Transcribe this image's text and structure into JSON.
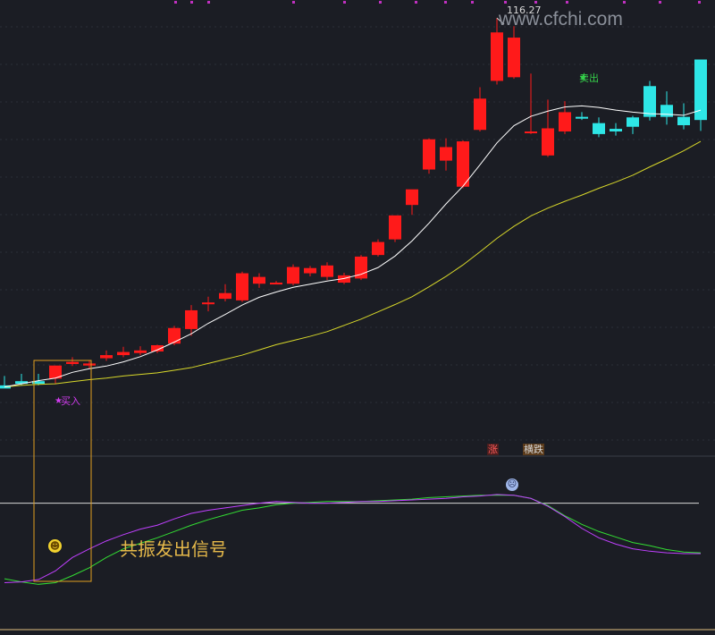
{
  "watermark": "www.cfchi.com",
  "annotations": {
    "peak_price": "116.27",
    "buy_signal": "买入",
    "sell_signal": "卖出",
    "resonance_text": "共振发出信号",
    "tag_rise": "涨",
    "tag_fall": "横跌",
    "buy_marker_icon": "star-icon",
    "sell_marker_icon": "star-icon",
    "smile_icon": "smiley-face-icon",
    "sad_icon": "sad-face-icon"
  },
  "colors": {
    "background": "#1b1d24",
    "up_candle": "#ff1a1a",
    "down_candle": "#2ee6e6",
    "ma_short": "#ffffff",
    "ma_long": "#d8d82a",
    "osc_fast": "#c040ff",
    "osc_slow": "#33dd33",
    "highlight_box": "#e0a020"
  },
  "chart_data": {
    "type": "candlestick",
    "ylim": [
      36,
      118
    ],
    "candles": [
      {
        "o": 45.8,
        "h": 47.6,
        "l": 45.3,
        "c": 45.2,
        "dir": "down"
      },
      {
        "o": 46.6,
        "h": 48.0,
        "l": 45.8,
        "c": 46.1,
        "dir": "down"
      },
      {
        "o": 46.6,
        "h": 48.0,
        "l": 45.8,
        "c": 46.1,
        "dir": "down"
      },
      {
        "o": 47.1,
        "h": 48.7,
        "l": 46.1,
        "c": 49.6,
        "dir": "up"
      },
      {
        "o": 49.9,
        "h": 51.2,
        "l": 49.5,
        "c": 50.3,
        "dir": "up"
      },
      {
        "o": 49.6,
        "h": 50.6,
        "l": 49.0,
        "c": 50.0,
        "dir": "up"
      },
      {
        "o": 51.0,
        "h": 52.5,
        "l": 50.5,
        "c": 51.6,
        "dir": "up"
      },
      {
        "o": 51.6,
        "h": 53.2,
        "l": 51.2,
        "c": 52.2,
        "dir": "up"
      },
      {
        "o": 52.0,
        "h": 53.3,
        "l": 51.6,
        "c": 52.5,
        "dir": "up"
      },
      {
        "o": 52.3,
        "h": 53.6,
        "l": 52.0,
        "c": 53.5,
        "dir": "up"
      },
      {
        "o": 53.8,
        "h": 57.2,
        "l": 53.5,
        "c": 56.8,
        "dir": "up"
      },
      {
        "o": 56.6,
        "h": 61.2,
        "l": 55.3,
        "c": 60.2,
        "dir": "up"
      },
      {
        "o": 61.5,
        "h": 62.8,
        "l": 60.0,
        "c": 61.7,
        "dir": "up"
      },
      {
        "o": 62.4,
        "h": 65.2,
        "l": 61.9,
        "c": 63.5,
        "dir": "up"
      },
      {
        "o": 62.1,
        "h": 67.6,
        "l": 61.8,
        "c": 67.3,
        "dir": "up"
      },
      {
        "o": 65.3,
        "h": 67.3,
        "l": 64.5,
        "c": 66.6,
        "dir": "up"
      },
      {
        "o": 65.5,
        "h": 65.8,
        "l": 65.2,
        "c": 65.5,
        "dir": "up"
      },
      {
        "o": 65.3,
        "h": 69.0,
        "l": 65.0,
        "c": 68.5,
        "dir": "up"
      },
      {
        "o": 67.3,
        "h": 68.7,
        "l": 66.7,
        "c": 68.3,
        "dir": "up"
      },
      {
        "o": 66.6,
        "h": 69.4,
        "l": 66.0,
        "c": 68.8,
        "dir": "up"
      },
      {
        "o": 65.5,
        "h": 67.4,
        "l": 65.2,
        "c": 66.9,
        "dir": "up"
      },
      {
        "o": 66.3,
        "h": 70.8,
        "l": 66.0,
        "c": 70.5,
        "dir": "up"
      },
      {
        "o": 70.8,
        "h": 73.8,
        "l": 70.5,
        "c": 73.3,
        "dir": "up"
      },
      {
        "o": 73.8,
        "h": 77.4,
        "l": 73.3,
        "c": 78.4,
        "dir": "up"
      },
      {
        "o": 80.4,
        "h": 82.3,
        "l": 78.5,
        "c": 83.4,
        "dir": "up"
      },
      {
        "o": 87.2,
        "h": 93.2,
        "l": 86.4,
        "c": 93.0,
        "dir": "up"
      },
      {
        "o": 88.9,
        "h": 93.2,
        "l": 87.0,
        "c": 91.5,
        "dir": "up"
      },
      {
        "o": 83.9,
        "h": 92.8,
        "l": 83.6,
        "c": 92.6,
        "dir": "up"
      },
      {
        "o": 94.8,
        "h": 103.0,
        "l": 94.5,
        "c": 100.8,
        "dir": "up"
      },
      {
        "o": 104.2,
        "h": 116.27,
        "l": 103.5,
        "c": 113.5,
        "dir": "up"
      },
      {
        "o": 104.9,
        "h": 114.7,
        "l": 104.6,
        "c": 112.5,
        "dir": "up"
      },
      {
        "o": 94.5,
        "h": 105.6,
        "l": 94.0,
        "c": 94.4,
        "dir": "up"
      },
      {
        "o": 89.9,
        "h": 100.6,
        "l": 89.6,
        "c": 95.1,
        "dir": "up"
      },
      {
        "o": 94.5,
        "h": 100.3,
        "l": 94.0,
        "c": 98.2,
        "dir": "up"
      },
      {
        "o": 97.3,
        "h": 98.2,
        "l": 96.7,
        "c": 97.2,
        "dir": "down"
      },
      {
        "o": 96.1,
        "h": 97.2,
        "l": 93.4,
        "c": 94.0,
        "dir": "down"
      },
      {
        "o": 95.0,
        "h": 96.1,
        "l": 93.7,
        "c": 94.5,
        "dir": "down"
      },
      {
        "o": 97.2,
        "h": 97.5,
        "l": 94.0,
        "c": 95.4,
        "dir": "down"
      },
      {
        "o": 103.2,
        "h": 104.2,
        "l": 96.6,
        "c": 97.3,
        "dir": "down"
      },
      {
        "o": 99.6,
        "h": 102.2,
        "l": 95.8,
        "c": 97.3,
        "dir": "down"
      },
      {
        "o": 97.3,
        "h": 99.9,
        "l": 94.9,
        "c": 95.7,
        "dir": "down"
      },
      {
        "o": 96.7,
        "h": 105.0,
        "l": 94.6,
        "c": 108.3,
        "dir": "down"
      }
    ],
    "ma_short": [
      45.5,
      46.1,
      46.7,
      47.2,
      48.3,
      49.0,
      49.5,
      50.3,
      51.3,
      52.6,
      54.1,
      55.7,
      57.7,
      59.4,
      61.2,
      62.7,
      63.7,
      64.6,
      65.2,
      65.8,
      66.3,
      67.1,
      68.4,
      70.6,
      73.5,
      76.9,
      80.6,
      84.0,
      88.1,
      92.3,
      95.6,
      97.4,
      98.4,
      99.2,
      99.4,
      99.1,
      98.6,
      98.2,
      97.9,
      97.8,
      97.6,
      98.6
    ],
    "ma_long": [
      45.5,
      45.8,
      46.0,
      46.1,
      46.5,
      46.9,
      47.2,
      47.6,
      47.9,
      48.2,
      48.7,
      49.2,
      50.0,
      50.8,
      51.6,
      52.6,
      53.6,
      54.4,
      55.2,
      56.1,
      57.3,
      58.5,
      59.9,
      61.3,
      62.8,
      64.7,
      66.7,
      68.9,
      71.4,
      74.0,
      76.3,
      78.3,
      79.8,
      81.1,
      82.3,
      83.6,
      84.8,
      86.1,
      87.7,
      89.2,
      90.8,
      92.6
    ],
    "osc_fast": [
      -6.5,
      -6.4,
      -6.1,
      -5.0,
      -3.3,
      -2.2,
      -1.2,
      -0.4,
      0.3,
      0.8,
      1.6,
      2.3,
      2.7,
      3.0,
      3.3,
      3.6,
      3.8,
      3.7,
      3.6,
      3.6,
      3.7,
      3.8,
      3.8,
      3.9,
      4.0,
      4.1,
      4.2,
      4.4,
      4.5,
      4.7,
      4.6,
      4.2,
      3.2,
      1.9,
      0.4,
      -0.8,
      -1.6,
      -2.2,
      -2.5,
      -2.7,
      -2.8,
      -2.8
    ],
    "osc_slow": [
      -6.0,
      -6.4,
      -6.7,
      -6.5,
      -5.6,
      -4.6,
      -3.3,
      -2.2,
      -1.5,
      -0.8,
      0.0,
      0.8,
      1.5,
      2.1,
      2.7,
      3.0,
      3.4,
      3.6,
      3.7,
      3.8,
      3.8,
      3.8,
      3.9,
      4.0,
      4.1,
      4.3,
      4.4,
      4.5,
      4.6,
      4.6,
      4.6,
      4.2,
      3.3,
      2.0,
      0.9,
      0.0,
      -0.7,
      -1.4,
      -1.8,
      -2.3,
      -2.6,
      -2.7
    ],
    "osc_zero_line": 3.6,
    "osc_ylim": [
      -12,
      9
    ],
    "buy_index": 3,
    "sell_index": 34,
    "peak_index": 29
  }
}
